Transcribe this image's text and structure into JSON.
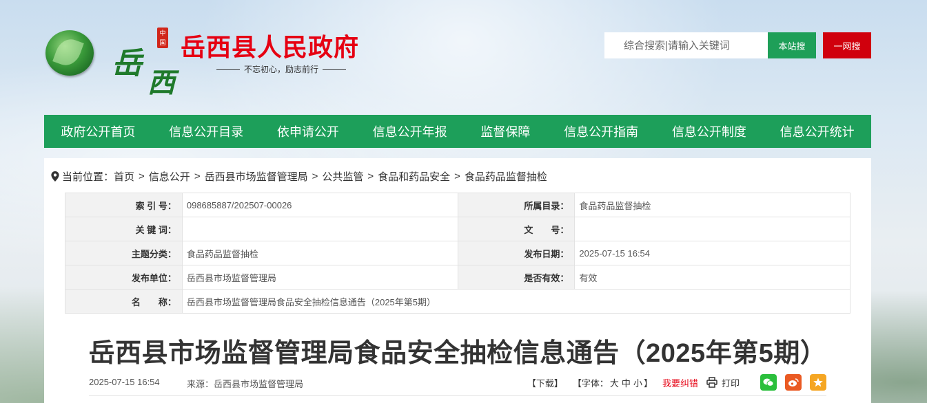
{
  "header": {
    "emblem_char_1": "岳",
    "emblem_char_2": "西",
    "seal_text": "中国",
    "site_title": "岳西县人民政府",
    "slogan": "不忘初心，励志前行",
    "search": {
      "placeholder": "综合搜索|请输入关键词",
      "site_button": "本站搜",
      "web_button": "一网搜"
    }
  },
  "colors": {
    "brand_green": "#1d9f5a",
    "brand_red": "#e60012",
    "search_red": "#d0000d"
  },
  "nav": {
    "items": [
      {
        "label": "政府公开首页"
      },
      {
        "label": "信息公开目录"
      },
      {
        "label": "依申请公开"
      },
      {
        "label": "信息公开年报"
      },
      {
        "label": "监督保障"
      },
      {
        "label": "信息公开指南"
      },
      {
        "label": "信息公开制度"
      },
      {
        "label": "信息公开统计"
      }
    ]
  },
  "breadcrumb": {
    "prefix": "当前位置：",
    "items": [
      "首页",
      "信息公开",
      "岳西县市场监督管理局",
      "公共监管",
      "食品和药品安全",
      "食品药品监督抽检"
    ],
    "separator": ">"
  },
  "meta": {
    "index_no_label": "索 引 号：",
    "index_no": "098685887/202507-00026",
    "catalog_label": "所属目录：",
    "catalog": "食品药品监督抽检",
    "keywords_label": "关 键 词：",
    "keywords": "",
    "doc_no_label": "文　　号：",
    "doc_no": "",
    "topic_label": "主题分类：",
    "topic": "食品药品监督抽检",
    "publish_date_label": "发布日期：",
    "publish_date": "2025-07-15 16:54",
    "publisher_label": "发布单位：",
    "publisher": "岳西县市场监督管理局",
    "valid_label": "是否有效：",
    "valid": "有效",
    "name_label": "名　　称：",
    "name": "岳西县市场监督管理局食品安全抽检信息通告（2025年第5期）"
  },
  "article": {
    "title": "岳西县市场监督管理局食品安全抽检信息通告（2025年第5期）",
    "date": "2025-07-15 16:54",
    "source": "来源：岳西县市场监督管理局",
    "download": "【下载】",
    "font_prefix": "【字体：",
    "font_large": "大",
    "font_medium": "中",
    "font_small": "小",
    "font_suffix": "】",
    "error_report": "我要纠错",
    "print": "打印",
    "share_icons": [
      "wechat-icon",
      "weibo-icon",
      "favorite-icon"
    ]
  }
}
